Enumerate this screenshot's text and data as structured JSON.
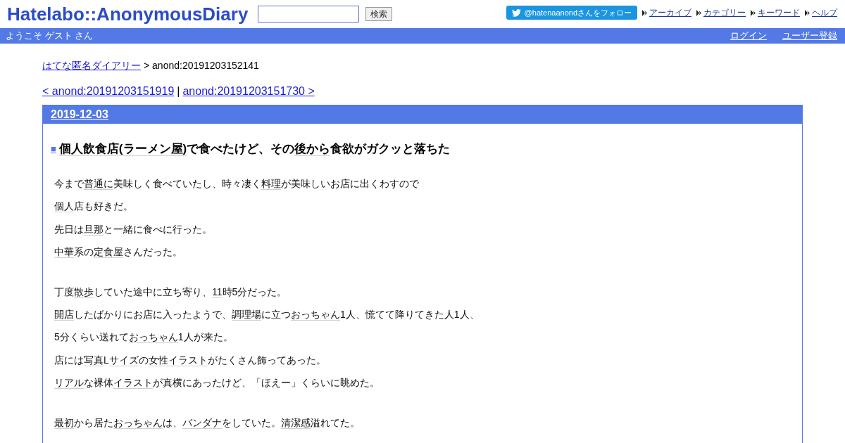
{
  "header": {
    "logo": "Hatelabo::AnonymousDiary",
    "search_button": "検索",
    "follow_button": "@hatenaanondさんをフォロー",
    "nav_links": [
      "アーカイブ",
      "カテゴリー",
      "キーワード",
      "ヘルプ"
    ]
  },
  "user_bar": {
    "greeting": "ようこそ ゲスト さん",
    "links": [
      "ログイン",
      "ユーザー登録"
    ]
  },
  "breadcrumb": {
    "link": "はてな匿名ダイアリー",
    "current": "> anond:20191203152141"
  },
  "pager": {
    "prev": "< anond:20191203151919",
    "separator": "|",
    "next": "anond:20191203151730 >"
  },
  "day": {
    "date": "2019-12-03",
    "entry": {
      "marker": "■",
      "title": [
        {
          "text": "個人飲食店(ラーメン屋)",
          "keyword": true
        },
        {
          "text": "で食べたけど、その",
          "keyword": false
        },
        {
          "text": "後から",
          "keyword": true
        },
        {
          "text": "食欲がガクッと落ちた",
          "keyword": false
        }
      ],
      "blocks": [
        [
          [
            {
              "text": "今まで",
              "keyword": false
            },
            {
              "text": "普通に",
              "keyword": true
            },
            {
              "text": "美味しく食べていたし、時々凄く",
              "keyword": false
            },
            {
              "text": "料理",
              "keyword": true
            },
            {
              "text": "が美味しいお店に出くわすので",
              "keyword": false
            }
          ],
          [
            {
              "text": "個人",
              "keyword": true
            },
            {
              "text": "店も好きだ。",
              "keyword": false
            }
          ],
          [
            {
              "text": "先日は",
              "keyword": false
            },
            {
              "text": "旦那",
              "keyword": true
            },
            {
              "text": "と一緒に食べに行った。",
              "keyword": false
            }
          ],
          [
            {
              "text": "中華",
              "keyword": true
            },
            {
              "text": "系の",
              "keyword": false
            },
            {
              "text": "定食屋",
              "keyword": true
            },
            {
              "text": "さんだった。",
              "keyword": false
            }
          ]
        ],
        [
          [
            {
              "text": "丁度",
              "keyword": false
            },
            {
              "text": "散歩",
              "keyword": true
            },
            {
              "text": "していた途中に立ち寄り、",
              "keyword": false
            },
            {
              "text": "11",
              "keyword": true
            },
            {
              "text": "時5分だった。",
              "keyword": false
            }
          ],
          [
            {
              "text": "開店",
              "keyword": true
            },
            {
              "text": "したばかりにお店に入ったようで、",
              "keyword": false
            },
            {
              "text": "調理場",
              "keyword": true
            },
            {
              "text": "に立つ",
              "keyword": false
            },
            {
              "text": "おっちゃん",
              "keyword": true
            },
            {
              "text": "1人、慌てて降りてきた人1人、",
              "keyword": false
            }
          ],
          [
            {
              "text": "5分くらい送れて",
              "keyword": false
            },
            {
              "text": "おっちゃん",
              "keyword": true
            },
            {
              "text": "1人が来た。",
              "keyword": false
            }
          ],
          [
            {
              "text": "店には",
              "keyword": false
            },
            {
              "text": "写真",
              "keyword": true
            },
            {
              "text": "L",
              "keyword": false
            },
            {
              "text": "サイズ",
              "keyword": true
            },
            {
              "text": "の",
              "keyword": false
            },
            {
              "text": "女性イラスト",
              "keyword": true
            },
            {
              "text": "がたくさん飾ってあった。",
              "keyword": false
            }
          ],
          [
            {
              "text": "リアル",
              "keyword": true
            },
            {
              "text": "な裸体",
              "keyword": false
            },
            {
              "text": "イラスト",
              "keyword": true
            },
            {
              "text": "が真横にあったけど、「ほえー」くらいに眺めた。",
              "keyword": false
            }
          ]
        ],
        [
          [
            {
              "text": "最初",
              "keyword": true
            },
            {
              "text": "から居た",
              "keyword": false
            },
            {
              "text": "おっちゃん",
              "keyword": true
            },
            {
              "text": "は、",
              "keyword": false
            },
            {
              "text": "バンダナ",
              "keyword": true
            },
            {
              "text": "をしていた。",
              "keyword": false
            },
            {
              "text": "清潔感",
              "keyword": true
            },
            {
              "text": "溢れてた。",
              "keyword": false
            }
          ]
        ]
      ]
    }
  }
}
